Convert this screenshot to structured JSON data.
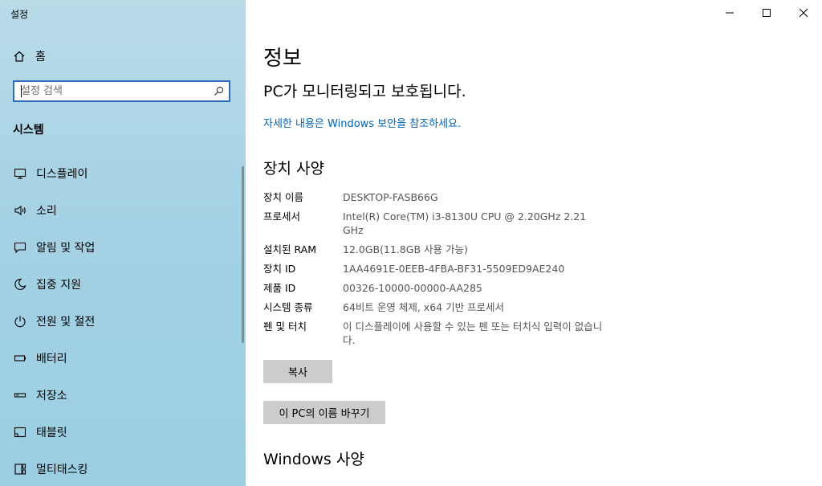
{
  "sidebar": {
    "app_title": "설정",
    "home_label": "홈",
    "search_placeholder": "설정 검색",
    "section_title": "시스템",
    "items": [
      {
        "label": "디스플레이",
        "icon": "monitor-icon"
      },
      {
        "label": "소리",
        "icon": "speaker-icon"
      },
      {
        "label": "알림 및 작업",
        "icon": "notification-icon"
      },
      {
        "label": "집중 지원",
        "icon": "moon-icon"
      },
      {
        "label": "전원 및 절전",
        "icon": "power-icon"
      },
      {
        "label": "배터리",
        "icon": "battery-icon"
      },
      {
        "label": "저장소",
        "icon": "storage-icon"
      },
      {
        "label": "태블릿",
        "icon": "tablet-icon"
      },
      {
        "label": "멀티태스킹",
        "icon": "multitask-icon"
      }
    ]
  },
  "main": {
    "title": "정보",
    "status": "PC가 모니터링되고 보호됩니다.",
    "link": "자세한 내용은 Windows 보안을 참조하세요.",
    "device_heading": "장치 사양",
    "specs": [
      {
        "key": "장치 이름",
        "value": "DESKTOP-FASB66G"
      },
      {
        "key": "프로세서",
        "value": "Intel(R) Core(TM) i3-8130U CPU @ 2.20GHz   2.21 GHz"
      },
      {
        "key": "설치된 RAM",
        "value": "12.0GB(11.8GB 사용 가능)"
      },
      {
        "key": "장치 ID",
        "value": "1AA4691E-0EEB-4FBA-BF31-5509ED9AE240"
      },
      {
        "key": "제품 ID",
        "value": "00326-10000-00000-AA285"
      },
      {
        "key": "시스템 종류",
        "value": "64비트 운영 체제, x64 기반 프로세서"
      },
      {
        "key": "펜 및 터치",
        "value": "이 디스플레이에 사용할 수 있는 펜 또는 터치식 입력이 없습니다."
      }
    ],
    "copy_button": "복사",
    "rename_button": "이 PC의 이름 바꾸기",
    "windows_heading": "Windows 사양"
  },
  "colors": {
    "sidebar_bg": "#a5d2e4",
    "accent": "#0063b1",
    "button_bg": "#cccccc"
  }
}
